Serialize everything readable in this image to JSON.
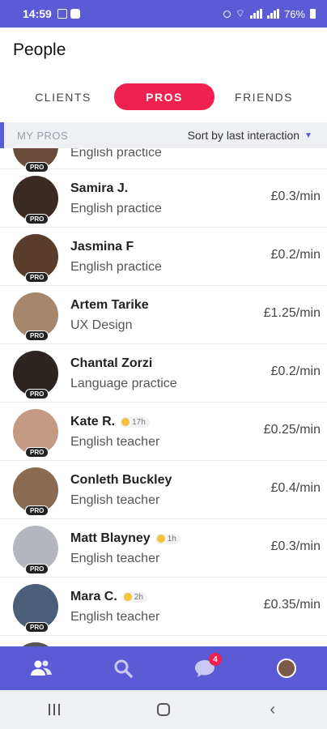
{
  "status_bar": {
    "time": "14:59",
    "battery": "76%"
  },
  "header": {
    "title": "People"
  },
  "tabs": [
    {
      "label": "CLIENTS"
    },
    {
      "label": "PROS"
    },
    {
      "label": "FRIENDS"
    }
  ],
  "section": {
    "title": "MY PROS",
    "sort_label": "Sort by last interaction"
  },
  "partial_item": {
    "subtitle": "English practice",
    "badge": "PRO"
  },
  "pros": [
    {
      "name": "Samira J.",
      "subtitle": "English practice",
      "price": "£0.3/min",
      "online": "",
      "badge": "PRO",
      "avatar_color": "#3b2a22"
    },
    {
      "name": "Jasmina F",
      "subtitle": "English practice",
      "price": "£0.2/min",
      "online": "",
      "badge": "PRO",
      "avatar_color": "#5a3c2c"
    },
    {
      "name": "Artem Tarike",
      "subtitle": "UX Design",
      "price": "£1.25/min",
      "online": "",
      "badge": "PRO",
      "avatar_color": "#a8866c"
    },
    {
      "name": "Chantal Zorzi",
      "subtitle": "Language practice",
      "price": "£0.2/min",
      "online": "",
      "badge": "PRO",
      "avatar_color": "#2c2420"
    },
    {
      "name": "Kate R.",
      "subtitle": "English teacher",
      "price": "£0.25/min",
      "online": "17h",
      "badge": "PRO",
      "avatar_color": "#c49a82"
    },
    {
      "name": "Conleth Buckley",
      "subtitle": "English teacher",
      "price": "£0.4/min",
      "online": "",
      "badge": "PRO",
      "avatar_color": "#8d6a52"
    },
    {
      "name": "Matt Blayney",
      "subtitle": "English teacher",
      "price": "£0.3/min",
      "online": "1h",
      "badge": "PRO",
      "avatar_color": "#b4b8be"
    },
    {
      "name": "Mara C.",
      "subtitle": "English teacher",
      "price": "£0.35/min",
      "online": "2h",
      "badge": "PRO",
      "avatar_color": "#4c5d7a"
    }
  ],
  "bottom_nav": {
    "items": [
      {
        "icon": "people-icon"
      },
      {
        "icon": "search-icon"
      },
      {
        "icon": "chat-icon",
        "badge": "4"
      },
      {
        "icon": "profile-avatar"
      }
    ]
  },
  "colors": {
    "accent": "#5b5bd6",
    "active_tab": "#f0214f",
    "coin": "#f4c23d"
  }
}
